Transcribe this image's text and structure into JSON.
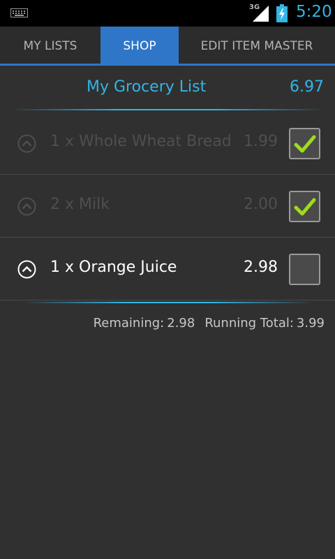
{
  "status": {
    "network": "3G",
    "time": "5:20"
  },
  "tabs": [
    {
      "label": "MY LISTS",
      "active": false
    },
    {
      "label": "SHOP",
      "active": true
    },
    {
      "label": "EDIT ITEM MASTER",
      "active": false
    }
  ],
  "list": {
    "title": "My Grocery List",
    "total": "6.97"
  },
  "items": [
    {
      "label": "1 x Whole Wheat Bread",
      "price": "1.99",
      "checked": true
    },
    {
      "label": "2 x Milk",
      "price": "2.00",
      "checked": true
    },
    {
      "label": "1 x Orange Juice",
      "price": "2.98",
      "checked": false
    }
  ],
  "summary": {
    "remaining_label": "Remaining:",
    "remaining_value": "2.98",
    "running_label": "Running Total:",
    "running_value": "3.99"
  },
  "colors": {
    "accent": "#33b5e5",
    "tab_active": "#2f76c9",
    "check": "#9fdb1d"
  }
}
